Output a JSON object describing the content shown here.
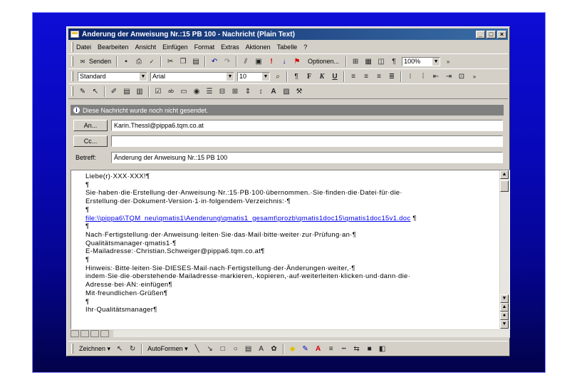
{
  "window": {
    "title": "Änderung der Anweisung Nr.:15 PB 100 - Nachricht (Plain Text)",
    "minimize": "_",
    "maximize": "□",
    "close": "×"
  },
  "menu": [
    "Datei",
    "Bearbeiten",
    "Ansicht",
    "Einfügen",
    "Format",
    "Extras",
    "Aktionen",
    "Tabelle",
    "?"
  ],
  "toolbar1": {
    "send_label": "Senden",
    "options_label": "Optionen...",
    "zoom_value": "100%"
  },
  "toolbar2": {
    "style_value": "Standard",
    "font_value": "Arial",
    "size_value": "10",
    "bold": "F",
    "italic": "K",
    "underline": "U"
  },
  "infobar": {
    "text": "Diese Nachricht wurde noch nicht gesendet."
  },
  "header": {
    "to_button": "An...",
    "to_value": "Karin.Thessl@pippa6.tqm.co.at",
    "cc_button": "Cc...",
    "cc_value": "",
    "subject_label": "Betreff:",
    "subject_value": "Änderung der Anweisung Nr.:15 PB 100"
  },
  "body": {
    "lines": [
      "Liebe(r)·XXX·XXX!¶",
      "¶",
      "Sie·haben·die·Erstellung·der·Anweisung·Nr.:15·PB·100·übernommen.·Sie·finden·die·Datei·für·die·",
      "Erstellung·der·Dokument-Version·1·in·folgendem·Verzeichnis:·¶",
      "¶",
      "",
      "¶",
      " Nach·Fertigstellung·der·Anweisung·leiten·Sie·das·Mail·bitte·weiter·zur·Prüfung·an·¶",
      "Qualitätsmanager·qmatis1·¶",
      "E-Mailadresse:·Christian.Schweiger@pippa6.tqm.co.at¶",
      "¶",
      "Hinweis:·Bitte·leiten·Sie·DIESES·Mail·nach·Fertigstellung·der·Änderungen·weiter,·¶",
      "indem·Sie·die·oberstehende·Mailadresse·markieren,·kopieren,·auf·weiterleiten·klicken·und·dann·die·",
      "Adresse·bei·AN:·einfügen¶",
      "Mit·freundlichen·Grüßen¶",
      "¶",
      "Ihr·Qualitätsmanager¶"
    ],
    "link": "file:\\\\pippa6\\TQM_neu\\qmatis1\\Aenderung\\qmatis1_gesamt\\prozb\\qmatis1doc15\\qmatis1doc15v1.doc",
    "link_suffix": " ¶"
  },
  "drawing": {
    "draw_label": "Zeichnen",
    "autoshapes_label": "AutoFormen"
  }
}
